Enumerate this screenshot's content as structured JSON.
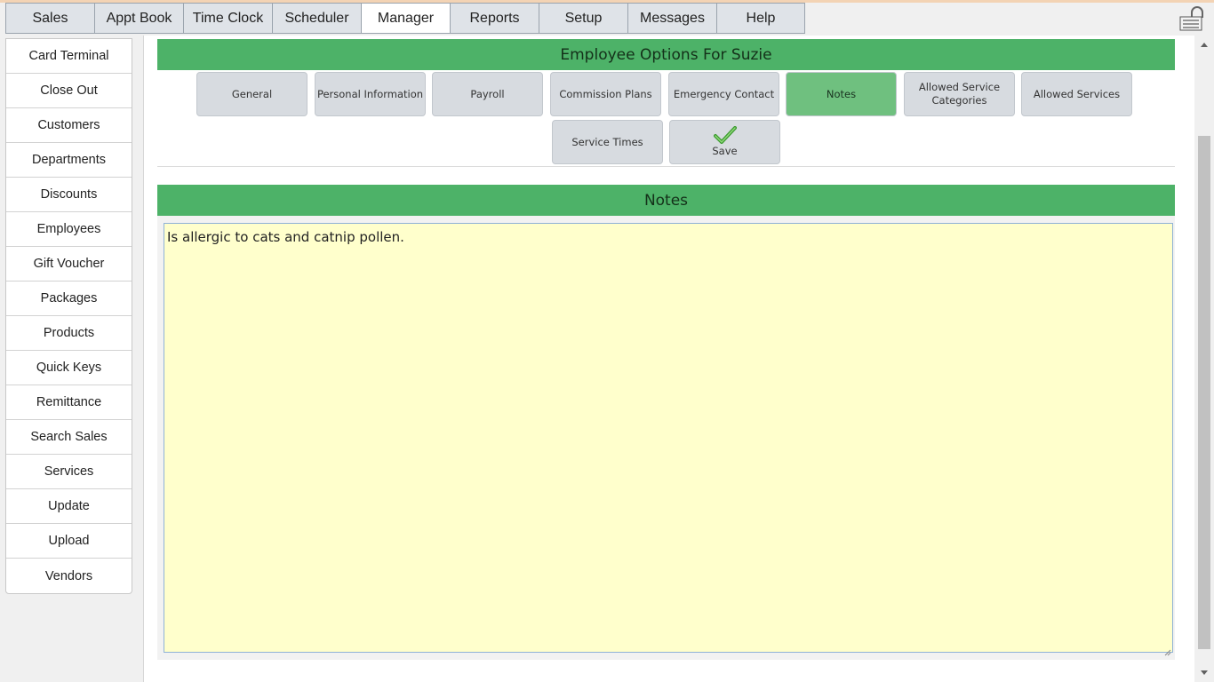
{
  "top_tabs": [
    {
      "label": "Sales"
    },
    {
      "label": "Appt Book"
    },
    {
      "label": "Time Clock"
    },
    {
      "label": "Scheduler"
    },
    {
      "label": "Manager",
      "active": true
    },
    {
      "label": "Reports"
    },
    {
      "label": "Setup"
    },
    {
      "label": "Messages"
    },
    {
      "label": "Help"
    }
  ],
  "sidebar": {
    "items": [
      {
        "label": "Card Terminal"
      },
      {
        "label": "Close Out"
      },
      {
        "label": "Customers"
      },
      {
        "label": "Departments"
      },
      {
        "label": "Discounts"
      },
      {
        "label": "Employees"
      },
      {
        "label": "Gift Voucher"
      },
      {
        "label": "Packages"
      },
      {
        "label": "Products"
      },
      {
        "label": "Quick Keys"
      },
      {
        "label": "Remittance"
      },
      {
        "label": "Search Sales"
      },
      {
        "label": "Services"
      },
      {
        "label": "Update"
      },
      {
        "label": "Upload"
      },
      {
        "label": "Vendors"
      }
    ]
  },
  "main": {
    "title": "Employee Options For Suzie",
    "option_buttons": [
      {
        "label": "General"
      },
      {
        "label": "Personal Information"
      },
      {
        "label": "Payroll"
      },
      {
        "label": "Commission Plans"
      },
      {
        "label": "Emergency Contact"
      },
      {
        "label": "Notes",
        "active": true
      },
      {
        "label": "Allowed Service Categories"
      },
      {
        "label": "Allowed Services"
      },
      {
        "label": "Service Times"
      }
    ],
    "save_label": "Save",
    "notes_title": "Notes",
    "notes_text": "Is allergic to cats and catnip pollen."
  },
  "colors": {
    "header_green": "#4db268",
    "active_button": "#6fc07f",
    "notes_background": "#ffffcc"
  },
  "icons": {
    "save": "checkmark-icon",
    "logout": "lock-icon"
  }
}
